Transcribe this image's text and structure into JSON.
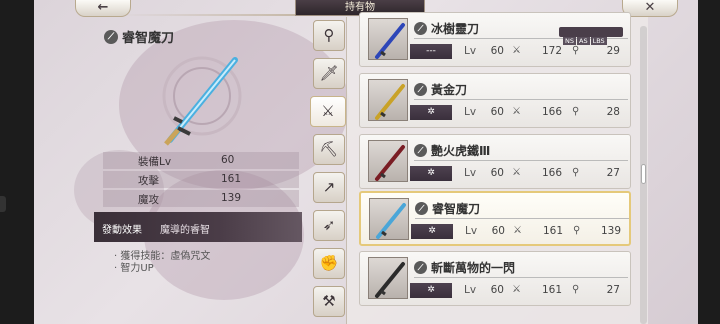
{
  "header": {
    "title": "持有物",
    "back_icon": "back-arrow-icon",
    "close_icon": "close-x-icon"
  },
  "detail": {
    "name": "睿智魔刀",
    "stats": [
      {
        "label": "裝備Lv",
        "value": "60"
      },
      {
        "label": "攻擊",
        "value": "161"
      },
      {
        "label": "魔攻",
        "value": "139"
      }
    ],
    "effect_label": "發動效果",
    "effect_value": "魔導的睿智",
    "effect_lines": [
      "· 獲得技能：虛偽咒文",
      "· 智力UP"
    ]
  },
  "tabs": [
    {
      "icon": "staff-icon",
      "glyph": "⚲"
    },
    {
      "icon": "sword-icon",
      "glyph": "🗡"
    },
    {
      "icon": "katana-icon",
      "glyph": "⚔"
    },
    {
      "icon": "axe-icon",
      "glyph": "⛏"
    },
    {
      "icon": "spear-icon",
      "glyph": "↗"
    },
    {
      "icon": "bow-icon",
      "glyph": "➶"
    },
    {
      "icon": "fist-icon",
      "glyph": "✊"
    },
    {
      "icon": "hammer-icon",
      "glyph": "⚒"
    }
  ],
  "active_tab": 2,
  "badge": {
    "tags": [
      "NS",
      "AS",
      "LBS"
    ]
  },
  "weapons": [
    {
      "name": "冰樹靈刀",
      "skill": "---",
      "lv_label": "Lv",
      "lv": "60",
      "atk": "172",
      "mag": "29",
      "blade_color": "#2d46b8",
      "selected": false
    },
    {
      "name": "黃金刀",
      "skill": "✲",
      "lv_label": "Lv",
      "lv": "60",
      "atk": "166",
      "mag": "28",
      "blade_color": "#c9a227",
      "selected": false
    },
    {
      "name": "艷火虎鐵Ⅲ",
      "skill": "✲",
      "lv_label": "Lv",
      "lv": "60",
      "atk": "166",
      "mag": "27",
      "blade_color": "#7a1d24",
      "selected": false
    },
    {
      "name": "睿智魔刀",
      "skill": "✲",
      "lv_label": "Lv",
      "lv": "60",
      "atk": "161",
      "mag": "139",
      "blade_color": "#4aa6d8",
      "selected": true
    },
    {
      "name": "斬斷萬物的一閃",
      "skill": "✲",
      "lv_label": "Lv",
      "lv": "60",
      "atk": "161",
      "mag": "27",
      "blade_color": "#2b2b2b",
      "selected": false
    }
  ]
}
